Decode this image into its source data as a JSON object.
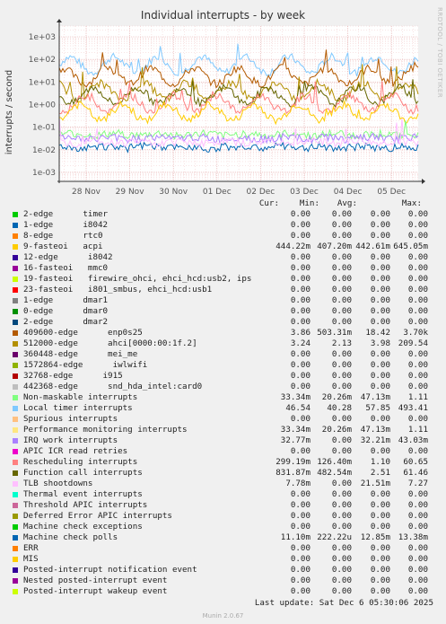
{
  "chart_data": {
    "type": "line",
    "title": "Individual interrupts - by week",
    "ylabel": "interrupts / second",
    "yscale": "log",
    "ylim": [
      0.0004,
      3000
    ],
    "y_ticks": [
      "1e-03",
      "1e-02",
      "1e-01",
      "1e+00",
      "1e+01",
      "1e+02",
      "1e+03"
    ],
    "x_ticks": [
      "28 Nov",
      "29 Nov",
      "30 Nov",
      "01 Dec",
      "02 Dec",
      "03 Dec",
      "04 Dec",
      "05 Dec"
    ],
    "grid": true,
    "legend_columns": [
      "Cur:",
      "Min:",
      "Avg:",
      "Max:"
    ],
    "series": [
      {
        "name": "2-edge      timer",
        "color": "#00cc00",
        "cur": "0.00",
        "min": "0.00",
        "avg": "0.00",
        "max": "0.00"
      },
      {
        "name": "1-edge      i8042",
        "color": "#0066b3",
        "cur": "0.00",
        "min": "0.00",
        "avg": "0.00",
        "max": "0.00"
      },
      {
        "name": "8-edge      rtc0",
        "color": "#ff8000",
        "cur": "0.00",
        "min": "0.00",
        "avg": "0.00",
        "max": "0.00"
      },
      {
        "name": "9-fasteoi   acpi",
        "color": "#ffcc00",
        "cur": "444.22m",
        "min": "407.20m",
        "avg": "442.61m",
        "max": "645.05m"
      },
      {
        "name": "12-edge      i8042",
        "color": "#330099",
        "cur": "0.00",
        "min": "0.00",
        "avg": "0.00",
        "max": "0.00"
      },
      {
        "name": "16-fasteoi   mmc0",
        "color": "#990099",
        "cur": "0.00",
        "min": "0.00",
        "avg": "0.00",
        "max": "0.00"
      },
      {
        "name": "19-fasteoi   firewire_ohci, ehci_hcd:usb2, ips",
        "color": "#ccff00",
        "cur": "0.00",
        "min": "0.00",
        "avg": "0.00",
        "max": "0.00"
      },
      {
        "name": "23-fasteoi   i801_smbus, ehci_hcd:usb1",
        "color": "#ff0000",
        "cur": "0.00",
        "min": "0.00",
        "avg": "0.00",
        "max": "0.00"
      },
      {
        "name": "1-edge      dmar1",
        "color": "#808080",
        "cur": "0.00",
        "min": "0.00",
        "avg": "0.00",
        "max": "0.00"
      },
      {
        "name": "0-edge      dmar0",
        "color": "#008f00",
        "cur": "0.00",
        "min": "0.00",
        "avg": "0.00",
        "max": "0.00"
      },
      {
        "name": "2-edge      dmar2",
        "color": "#00487d",
        "cur": "0.00",
        "min": "0.00",
        "avg": "0.00",
        "max": "0.00"
      },
      {
        "name": "409600-edge      enp0s25",
        "color": "#b35a00",
        "cur": "3.86",
        "min": "503.31m",
        "avg": "18.42",
        "max": "3.70k"
      },
      {
        "name": "512000-edge      ahci[0000:00:1f.2]",
        "color": "#b38f00",
        "cur": "3.24",
        "min": "2.13",
        "avg": "3.98",
        "max": "209.54"
      },
      {
        "name": "360448-edge      mei_me",
        "color": "#6b006b",
        "cur": "0.00",
        "min": "0.00",
        "avg": "0.00",
        "max": "0.00"
      },
      {
        "name": "1572864-edge      iwlwifi",
        "color": "#8fb300",
        "cur": "0.00",
        "min": "0.00",
        "avg": "0.00",
        "max": "0.00"
      },
      {
        "name": "32768-edge      i915",
        "color": "#b30000",
        "cur": "0.00",
        "min": "0.00",
        "avg": "0.00",
        "max": "0.00"
      },
      {
        "name": "442368-edge      snd_hda_intel:card0",
        "color": "#bebebe",
        "cur": "0.00",
        "min": "0.00",
        "avg": "0.00",
        "max": "0.00"
      },
      {
        "name": "Non-maskable interrupts",
        "color": "#80ff80",
        "cur": "33.34m",
        "min": "20.26m",
        "avg": "47.13m",
        "max": "1.11"
      },
      {
        "name": "Local timer interrupts",
        "color": "#80c9ff",
        "cur": "46.54",
        "min": "40.28",
        "avg": "57.85",
        "max": "493.41"
      },
      {
        "name": "Spurious interrupts",
        "color": "#ffc080",
        "cur": "0.00",
        "min": "0.00",
        "avg": "0.00",
        "max": "0.00"
      },
      {
        "name": "Performance monitoring interrupts",
        "color": "#ffe680",
        "cur": "33.34m",
        "min": "20.26m",
        "avg": "47.13m",
        "max": "1.11"
      },
      {
        "name": "IRQ work interrupts",
        "color": "#aa80ff",
        "cur": "32.77m",
        "min": "0.00",
        "avg": "32.21m",
        "max": "43.03m"
      },
      {
        "name": "APIC ICR read retries",
        "color": "#ee00cc",
        "cur": "0.00",
        "min": "0.00",
        "avg": "0.00",
        "max": "0.00"
      },
      {
        "name": "Rescheduling interrupts",
        "color": "#ff8080",
        "cur": "299.19m",
        "min": "126.40m",
        "avg": "1.10",
        "max": "60.65"
      },
      {
        "name": "Function call interrupts",
        "color": "#666600",
        "cur": "831.87m",
        "min": "482.54m",
        "avg": "2.51",
        "max": "61.46"
      },
      {
        "name": "TLB shootdowns",
        "color": "#ffbfff",
        "cur": "7.78m",
        "min": "0.00",
        "avg": "21.51m",
        "max": "7.27"
      },
      {
        "name": "Thermal event interrupts",
        "color": "#00ffcc",
        "cur": "0.00",
        "min": "0.00",
        "avg": "0.00",
        "max": "0.00"
      },
      {
        "name": "Threshold APIC interrupts",
        "color": "#cc6699",
        "cur": "0.00",
        "min": "0.00",
        "avg": "0.00",
        "max": "0.00"
      },
      {
        "name": "Deferred Error APIC interrupts",
        "color": "#999900",
        "cur": "0.00",
        "min": "0.00",
        "avg": "0.00",
        "max": "0.00"
      },
      {
        "name": "Machine check exceptions",
        "color": "#00cc00",
        "cur": "0.00",
        "min": "0.00",
        "avg": "0.00",
        "max": "0.00"
      },
      {
        "name": "Machine check polls",
        "color": "#0066b3",
        "cur": "11.10m",
        "min": "222.22u",
        "avg": "12.85m",
        "max": "13.38m"
      },
      {
        "name": "ERR",
        "color": "#ff8000",
        "cur": "0.00",
        "min": "0.00",
        "avg": "0.00",
        "max": "0.00"
      },
      {
        "name": "MIS",
        "color": "#ffcc00",
        "cur": "0.00",
        "min": "0.00",
        "avg": "0.00",
        "max": "0.00"
      },
      {
        "name": "Posted-interrupt notification event",
        "color": "#330099",
        "cur": "0.00",
        "min": "0.00",
        "avg": "0.00",
        "max": "0.00"
      },
      {
        "name": "Nested posted-interrupt event",
        "color": "#990099",
        "cur": "0.00",
        "min": "0.00",
        "avg": "0.00",
        "max": "0.00"
      },
      {
        "name": "Posted-interrupt wakeup event",
        "color": "#ccff00",
        "cur": "0.00",
        "min": "0.00",
        "avg": "0.00",
        "max": "0.00"
      }
    ],
    "plotted": [
      {
        "name": "Local timer interrupts",
        "level": 57.85,
        "spike": 493.41,
        "color": "#80c9ff"
      },
      {
        "name": "409600-edge      enp0s25",
        "level": 18.42,
        "spike": 3700,
        "color": "#b35a00"
      },
      {
        "name": "512000-edge      ahci[0000:00:1f.2]",
        "level": 3.98,
        "spike": 209.54,
        "color": "#b38f00"
      },
      {
        "name": "Function call interrupts",
        "level": 2.51,
        "spike": 61.46,
        "color": "#666600"
      },
      {
        "name": "Rescheduling interrupts",
        "level": 1.1,
        "spike": 60.65,
        "color": "#ff8080"
      },
      {
        "name": "9-fasteoi   acpi",
        "level": 0.4426,
        "spike": 0.645,
        "color": "#ffcc00"
      },
      {
        "name": "Non-maskable interrupts",
        "level": 0.0471,
        "spike": 1.11,
        "color": "#80ff80"
      },
      {
        "name": "IRQ work interrupts",
        "level": 0.0322,
        "spike": 0.043,
        "color": "#aa80ff"
      },
      {
        "name": "Machine check polls",
        "level": 0.01285,
        "spike": 0.01338,
        "color": "#0066b3"
      },
      {
        "name": "TLB shootdowns",
        "level": 0.0215,
        "spike": 7.27,
        "color": "#ffbfff"
      }
    ]
  },
  "footer": {
    "last_update": "Last update: Sat Dec  6 05:30:06 2025",
    "munin": "Munin 2.0.67",
    "sidelabel": "RRDTOOL / TOBI OETIKER"
  }
}
